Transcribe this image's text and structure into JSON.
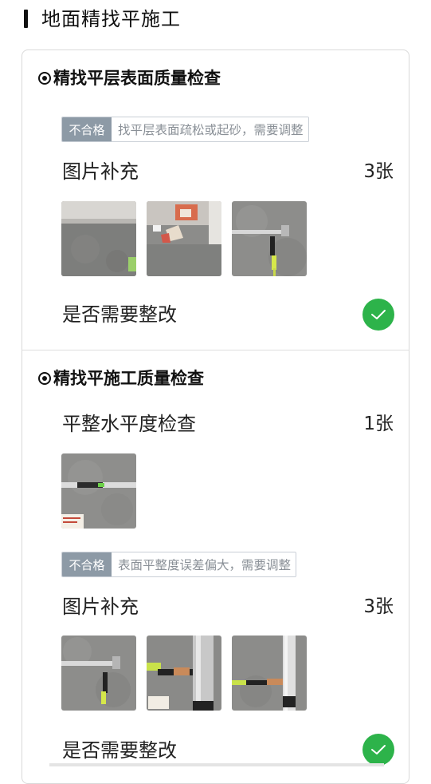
{
  "page": {
    "title": "地面精找平施工"
  },
  "section1": {
    "title": "精找平层表面质量检查",
    "tag": {
      "label": "不合格",
      "text": "找平层表面疏松或起砂，需要调整"
    },
    "supplement_label": "图片补充",
    "supplement_count": "3张",
    "rectify_label": "是否需要整改"
  },
  "section2": {
    "title": "精找平施工质量检查",
    "check_label": "平整水平度检查",
    "check_count": "1张",
    "tag": {
      "label": "不合格",
      "text": "表面平整度误差偏大，需要调整"
    },
    "supplement_label": "图片补充",
    "supplement_count": "3张",
    "rectify_label": "是否需要整改"
  },
  "colors": {
    "accent_green": "#2db34a",
    "tag_gray": "#8d9aa6"
  }
}
